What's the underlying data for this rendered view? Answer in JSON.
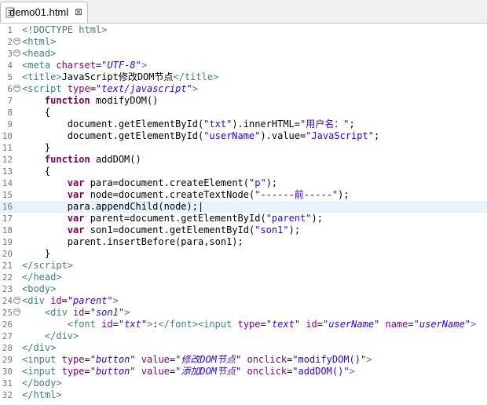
{
  "tab": {
    "title": "demo01.html",
    "close_symbol": "⊠",
    "icon": "html-file-icon"
  },
  "editor": {
    "current_line": 16,
    "lines": [
      {
        "n": "1",
        "fold": false,
        "html": "<span class=\"tag\">&lt;!DOCTYPE html&gt;</span>"
      },
      {
        "n": "2",
        "fold": true,
        "html": "<span class=\"tag\">&lt;html&gt;</span>"
      },
      {
        "n": "3",
        "fold": true,
        "html": "<span class=\"tag\">&lt;head&gt;</span>"
      },
      {
        "n": "4",
        "fold": false,
        "html": "<span class=\"tag\">&lt;meta</span> <span class=\"attr\">charset</span>=<span class=\"val\">\"UTF-8\"</span><span class=\"tag\">&gt;</span>"
      },
      {
        "n": "5",
        "fold": false,
        "html": "<span class=\"tag\">&lt;title&gt;</span>JavaScript修改DOM节点<span class=\"tag\">&lt;/title&gt;</span>"
      },
      {
        "n": "6",
        "fold": true,
        "html": "<span class=\"tag\">&lt;script</span> <span class=\"attr\">type</span>=<span class=\"val\">\"text/javascript\"</span><span class=\"tag\">&gt;</span>"
      },
      {
        "n": "7",
        "fold": false,
        "html": "    <span class=\"kw\">function</span> modifyDOM()"
      },
      {
        "n": "8",
        "fold": false,
        "html": "    {"
      },
      {
        "n": "9",
        "fold": false,
        "html": "        document.getElementById(<span class=\"str\">\"txt\"</span>).innerHTML=<span class=\"str\">\"用户名：\"</span>;"
      },
      {
        "n": "10",
        "fold": false,
        "html": "        document.getElementById(<span class=\"str\">\"userName\"</span>).value=<span class=\"str\">\"JavaScript\"</span>;"
      },
      {
        "n": "11",
        "fold": false,
        "html": "    }"
      },
      {
        "n": "12",
        "fold": false,
        "html": "    <span class=\"kw\">function</span> addDOM()"
      },
      {
        "n": "13",
        "fold": false,
        "html": "    {"
      },
      {
        "n": "14",
        "fold": false,
        "html": "        <span class=\"kw\">var</span> para=document.createElement(<span class=\"str\">\"p\"</span>);"
      },
      {
        "n": "15",
        "fold": false,
        "html": "        <span class=\"kw\">var</span> node=document.createTextNode(<span class=\"str\">\"------前-----\"</span>);"
      },
      {
        "n": "16",
        "fold": false,
        "html": "        para.appendChild(node);|"
      },
      {
        "n": "17",
        "fold": false,
        "html": "        <span class=\"kw\">var</span> parent=document.getElementById(<span class=\"str\">\"parent\"</span>);"
      },
      {
        "n": "18",
        "fold": false,
        "html": "        <span class=\"kw\">var</span> son1=document.getElementById(<span class=\"str\">\"son1\"</span>);"
      },
      {
        "n": "19",
        "fold": false,
        "html": "        parent.insertBefore(para,son1);"
      },
      {
        "n": "20",
        "fold": false,
        "html": "    }"
      },
      {
        "n": "21",
        "fold": false,
        "html": "<span class=\"tag\">&lt;/script&gt;</span>"
      },
      {
        "n": "22",
        "fold": false,
        "html": "<span class=\"tag\">&lt;/head&gt;</span>"
      },
      {
        "n": "23",
        "fold": false,
        "html": "<span class=\"tag\">&lt;body&gt;</span>"
      },
      {
        "n": "24",
        "fold": true,
        "html": "<span class=\"tag\">&lt;div</span> <span class=\"attr\">id</span>=<span class=\"val\">\"parent\"</span><span class=\"tag\">&gt;</span>"
      },
      {
        "n": "25",
        "fold": true,
        "html": "    <span class=\"tag\">&lt;div</span> <span class=\"attr\">id</span>=<span class=\"val\">\"son1\"</span><span class=\"tag\">&gt;</span>"
      },
      {
        "n": "26",
        "fold": false,
        "html": "        <span class=\"tag\">&lt;font</span> <span class=\"attr\">id</span>=<span class=\"val\">\"txt\"</span><span class=\"tag\">&gt;</span>:<span class=\"tag\">&lt;/font&gt;&lt;input</span> <span class=\"attr\">type</span>=<span class=\"val\">\"text\"</span> <span class=\"attr\">id</span>=<span class=\"val\">\"userName\"</span> <span class=\"attr\">name</span>=<span class=\"val\">\"userName\"</span><span class=\"tag\">&gt;</span>"
      },
      {
        "n": "27",
        "fold": false,
        "html": "    <span class=\"tag\">&lt;/div&gt;</span>"
      },
      {
        "n": "28",
        "fold": false,
        "html": "<span class=\"tag\">&lt;/div&gt;</span>"
      },
      {
        "n": "29",
        "fold": false,
        "html": "<span class=\"tag\">&lt;input</span> <span class=\"attr\">type</span>=<span class=\"val\">\"button\"</span> <span class=\"attr\">value</span>=<span class=\"val\">\"修改DOM节点\"</span> <span class=\"attr\">onclick</span>=<span class=\"str\">\"modifyDOM()\"</span><span class=\"tag\">&gt;</span>"
      },
      {
        "n": "30",
        "fold": false,
        "html": "<span class=\"tag\">&lt;input</span> <span class=\"attr\">type</span>=<span class=\"val\">\"button\"</span> <span class=\"attr\">value</span>=<span class=\"val\">\"添加DOM节点\"</span> <span class=\"attr\">onclick</span>=<span class=\"str\">\"addDOM()\"</span><span class=\"tag\">&gt;</span>"
      },
      {
        "n": "31",
        "fold": false,
        "html": "<span class=\"tag\">&lt;/body&gt;</span>"
      },
      {
        "n": "32",
        "fold": false,
        "html": "<span class=\"tag\">&lt;/html&gt;</span>"
      }
    ]
  }
}
